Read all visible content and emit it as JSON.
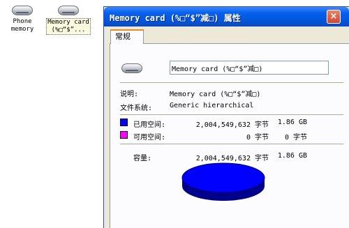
{
  "desktop": {
    "icons": [
      {
        "label_line1": "Phone",
        "label_line2": "memory",
        "icon": "drive-icon"
      },
      {
        "label_line1": "Memory card",
        "label_line2": "(%□“$”...",
        "icon": "drive-icon",
        "selected": true
      }
    ]
  },
  "window": {
    "title": "Memory card (%□“$”减□) 属性",
    "close_label": "×",
    "tab": "常规",
    "name_value": "Memory card (%□“$”减□)",
    "description_label": "说明:",
    "description_value": "Memory card (%□“$”减□)",
    "filesystem_label": "文件系统:",
    "filesystem_value": "Generic hierarchical",
    "used": {
      "label": "已用空间:",
      "bytes": "2,004,549,632 字节",
      "size": "1.86 GB",
      "color": "#0000ff"
    },
    "free": {
      "label": "可用空间:",
      "bytes": "0 字节",
      "size": "0 字节",
      "color": "#ff00ff"
    },
    "capacity": {
      "label": "容量:",
      "bytes": "2,004,549,632 字节",
      "size": "1.86 GB"
    },
    "pie": {
      "used_fraction": 1.0,
      "used_color": "#0000ff",
      "free_color": "#ff00ff"
    }
  }
}
